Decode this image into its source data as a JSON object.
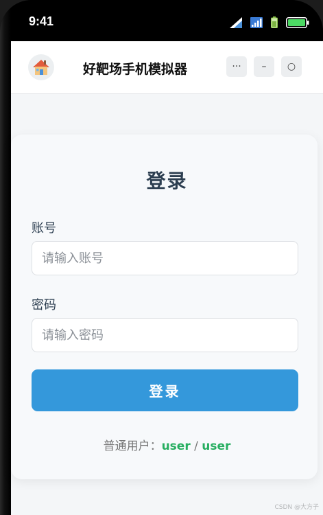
{
  "status_bar": {
    "time": "9:41"
  },
  "header": {
    "avatar_icon": "house-icon",
    "title": "好靶场手机模拟器",
    "menu_label": "···",
    "minimize_label": "–",
    "close_label": "○"
  },
  "login": {
    "title": "登录",
    "account_label": "账号",
    "account_placeholder": "请输入账号",
    "password_label": "密码",
    "password_placeholder": "请输入密码",
    "submit_label": "登录",
    "hint_prefix": "普通用户：",
    "hint_user": "user",
    "hint_sep": " / ",
    "hint_pass": "user"
  },
  "watermark": "CSDN @大方子",
  "colors": {
    "primary": "#3498db",
    "heading": "#2c3e50",
    "credential": "#27ae60"
  }
}
